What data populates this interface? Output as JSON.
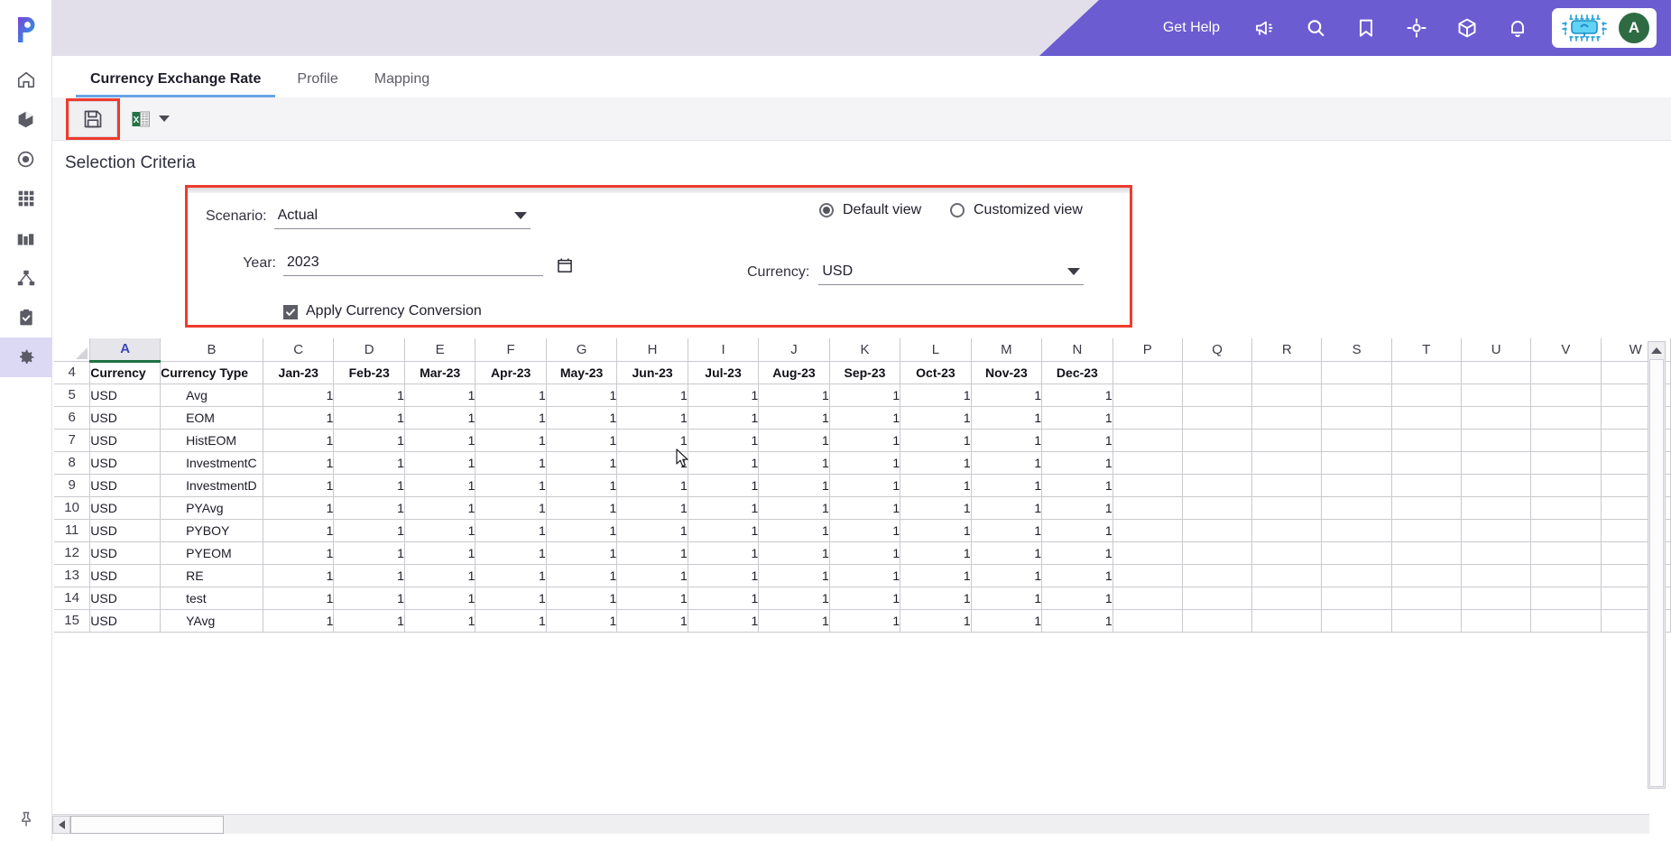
{
  "app": {
    "logo_name": "p-logo",
    "accent_purple": "#6c5cd1",
    "topbar_bg": "#e2dfeb",
    "highlight_red": "#ef3b2d"
  },
  "sidebar": {
    "items": [
      {
        "name": "home",
        "label": "Home",
        "icon": "home-icon",
        "active": false
      },
      {
        "name": "models",
        "label": "Models",
        "icon": "cube-icon",
        "active": false
      },
      {
        "name": "targets",
        "label": "Targets",
        "icon": "target-icon",
        "active": false
      },
      {
        "name": "grid",
        "label": "Grid",
        "icon": "grid-icon",
        "active": false
      },
      {
        "name": "reports",
        "label": "Reports",
        "icon": "bar-chart-icon",
        "active": false
      },
      {
        "name": "hierarchy",
        "label": "Hierarchy",
        "icon": "hierarchy-icon",
        "active": false
      },
      {
        "name": "tasks",
        "label": "Tasks",
        "icon": "clipboard-check-icon",
        "active": false
      },
      {
        "name": "settings",
        "label": "Settings",
        "icon": "gear-icon",
        "active": true
      }
    ],
    "pin": {
      "label": "Pin menu",
      "icon": "pin-icon"
    }
  },
  "topbar": {
    "get_help": "Get Help",
    "icons": [
      {
        "name": "announcement-icon"
      },
      {
        "name": "search-icon"
      },
      {
        "name": "bookmark-icon"
      },
      {
        "name": "crosshair-icon"
      },
      {
        "name": "package-icon"
      },
      {
        "name": "bell-icon"
      }
    ],
    "chip_icon": "ai-chip-icon",
    "avatar_initial": "A"
  },
  "tabs": [
    {
      "label": "Currency Exchange Rate",
      "active": true
    },
    {
      "label": "Profile",
      "active": false
    },
    {
      "label": "Mapping",
      "active": false
    }
  ],
  "toolbar": {
    "save": {
      "label": "Save",
      "icon": "floppy-disk-icon",
      "highlighted": true
    },
    "export": {
      "label": "Export to Excel",
      "icon": "excel-icon",
      "has_dropdown": true
    }
  },
  "selection_criteria": {
    "title": "Selection Criteria",
    "scenario": {
      "label": "Scenario:",
      "value": "Actual"
    },
    "year": {
      "label": "Year:",
      "value": "2023",
      "icon": "calendar-icon"
    },
    "apply_currency_conversion": {
      "label": "Apply Currency Conversion",
      "checked": true
    },
    "view_mode": {
      "options": [
        {
          "label": "Default view",
          "selected": true
        },
        {
          "label": "Customized view",
          "selected": false
        }
      ]
    },
    "currency": {
      "label": "Currency:",
      "value": "USD"
    }
  },
  "sheet": {
    "column_letters": [
      "A",
      "B",
      "C",
      "D",
      "E",
      "F",
      "G",
      "H",
      "I",
      "J",
      "K",
      "L",
      "M",
      "N",
      "P",
      "Q",
      "R",
      "S",
      "T",
      "U",
      "V",
      "W"
    ],
    "selected_column": "A",
    "row_numbers": [
      "4",
      "5",
      "6",
      "7",
      "8",
      "9",
      "10",
      "11",
      "12",
      "13",
      "14",
      "15"
    ],
    "header_row": {
      "number": "4",
      "cells": [
        "Currency",
        "Currency Type",
        "Jan-23",
        "Feb-23",
        "Mar-23",
        "Apr-23",
        "May-23",
        "Jun-23",
        "Jul-23",
        "Aug-23",
        "Sep-23",
        "Oct-23",
        "Nov-23",
        "Dec-23"
      ]
    },
    "rows": [
      {
        "number": "5",
        "currency": "USD",
        "type": "Avg",
        "values": [
          "1",
          "1",
          "1",
          "1",
          "1",
          "1",
          "1",
          "1",
          "1",
          "1",
          "1",
          "1"
        ]
      },
      {
        "number": "6",
        "currency": "USD",
        "type": "EOM",
        "values": [
          "1",
          "1",
          "1",
          "1",
          "1",
          "1",
          "1",
          "1",
          "1",
          "1",
          "1",
          "1"
        ]
      },
      {
        "number": "7",
        "currency": "USD",
        "type": "HistEOM",
        "values": [
          "1",
          "1",
          "1",
          "1",
          "1",
          "1",
          "1",
          "1",
          "1",
          "1",
          "1",
          "1"
        ]
      },
      {
        "number": "8",
        "currency": "USD",
        "type": "InvestmentC",
        "values": [
          "1",
          "1",
          "1",
          "1",
          "1",
          "1",
          "1",
          "1",
          "1",
          "1",
          "1",
          "1"
        ]
      },
      {
        "number": "9",
        "currency": "USD",
        "type": "InvestmentD",
        "values": [
          "1",
          "1",
          "1",
          "1",
          "1",
          "1",
          "1",
          "1",
          "1",
          "1",
          "1",
          "1"
        ]
      },
      {
        "number": "10",
        "currency": "USD",
        "type": "PYAvg",
        "values": [
          "1",
          "1",
          "1",
          "1",
          "1",
          "1",
          "1",
          "1",
          "1",
          "1",
          "1",
          "1"
        ]
      },
      {
        "number": "11",
        "currency": "USD",
        "type": "PYBOY",
        "values": [
          "1",
          "1",
          "1",
          "1",
          "1",
          "1",
          "1",
          "1",
          "1",
          "1",
          "1",
          "1"
        ]
      },
      {
        "number": "12",
        "currency": "USD",
        "type": "PYEOM",
        "values": [
          "1",
          "1",
          "1",
          "1",
          "1",
          "1",
          "1",
          "1",
          "1",
          "1",
          "1",
          "1"
        ]
      },
      {
        "number": "13",
        "currency": "USD",
        "type": "RE",
        "values": [
          "1",
          "1",
          "1",
          "1",
          "1",
          "1",
          "1",
          "1",
          "1",
          "1",
          "1",
          "1"
        ]
      },
      {
        "number": "14",
        "currency": "USD",
        "type": "test",
        "values": [
          "1",
          "1",
          "1",
          "1",
          "1",
          "1",
          "1",
          "1",
          "1",
          "1",
          "1",
          "1"
        ]
      },
      {
        "number": "15",
        "currency": "USD",
        "type": "YAvg",
        "values": [
          "1",
          "1",
          "1",
          "1",
          "1",
          "1",
          "1",
          "1",
          "1",
          "1",
          "1",
          "1"
        ]
      }
    ]
  }
}
